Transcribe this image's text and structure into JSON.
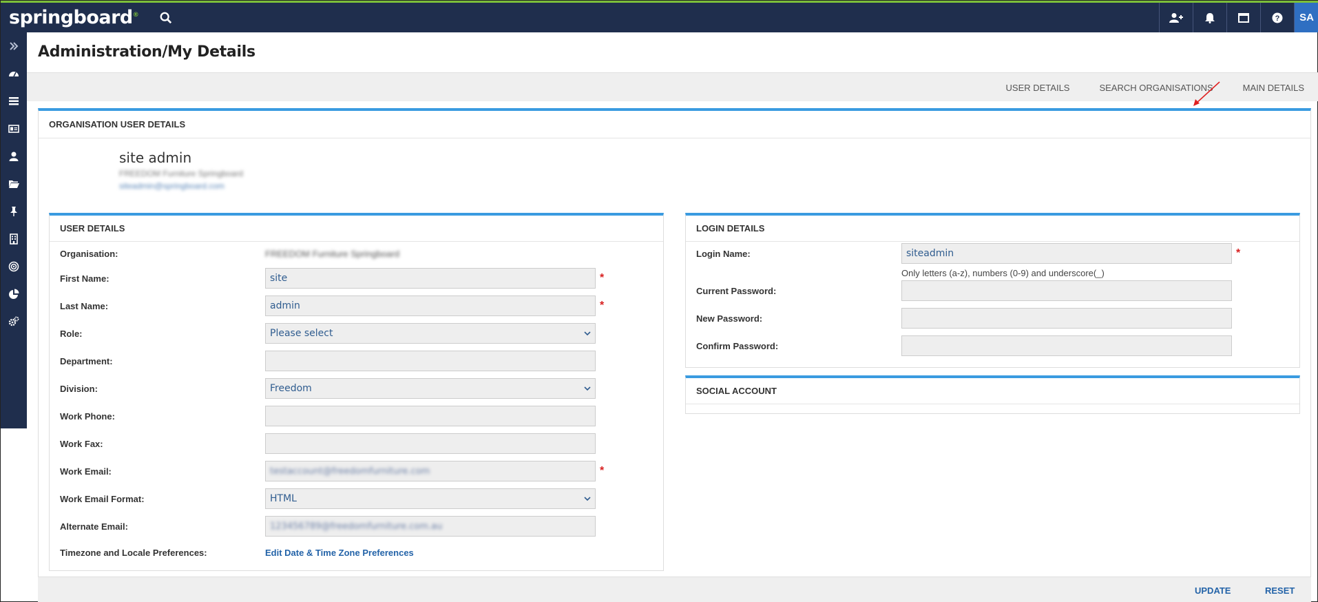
{
  "app": {
    "logo": "springboard",
    "logo_mark": "®"
  },
  "header": {
    "avatar_initials": "SA",
    "icons": [
      "search-icon",
      "add-user-icon",
      "bell-icon",
      "window-icon",
      "help-icon"
    ]
  },
  "page": {
    "title": "Administration/My Details"
  },
  "tabs": [
    {
      "label": "USER DETAILS"
    },
    {
      "label": "SEARCH ORGANISATIONS"
    },
    {
      "label": "MAIN DETAILS"
    }
  ],
  "org_section": {
    "title": "ORGANISATION USER DETAILS",
    "name": "site admin",
    "org_line": "FREEDOM Furniture Springboard",
    "email_line": "siteadmin@springboard.com"
  },
  "user_details": {
    "title": "USER DETAILS",
    "organisation": {
      "label": "Organisation:",
      "value": "FREEDOM Furniture Springboard"
    },
    "first_name": {
      "label": "First Name:",
      "value": "site"
    },
    "last_name": {
      "label": "Last Name:",
      "value": "admin"
    },
    "role": {
      "label": "Role:",
      "value": "Please select"
    },
    "department": {
      "label": "Department:",
      "value": ""
    },
    "division": {
      "label": "Division:",
      "value": "Freedom"
    },
    "work_phone": {
      "label": "Work Phone:",
      "value": ""
    },
    "work_fax": {
      "label": "Work Fax:",
      "value": ""
    },
    "work_email": {
      "label": "Work Email:",
      "value": "testaccount@freedomfurniture.com"
    },
    "work_email_format": {
      "label": "Work Email Format:",
      "value": "HTML"
    },
    "alternate_email": {
      "label": "Alternate Email:",
      "value": "123456789@freedomfurniture.com.au"
    },
    "timezone": {
      "label": "Timezone and Locale Preferences:",
      "link": "Edit Date & Time Zone Preferences"
    },
    "required_mark": "*"
  },
  "login_details": {
    "title": "LOGIN DETAILS",
    "login_name": {
      "label": "Login Name:",
      "value": "siteadmin"
    },
    "hint": "Only letters (a-z), numbers (0-9) and underscore(_)",
    "current_password": {
      "label": "Current Password:",
      "value": ""
    },
    "new_password": {
      "label": "New Password:",
      "value": ""
    },
    "confirm_password": {
      "label": "Confirm Password:",
      "value": ""
    }
  },
  "social_account": {
    "title": "SOCIAL ACCOUNT"
  },
  "footer": {
    "update_label": "UPDATE",
    "reset_label": "RESET"
  },
  "colors": {
    "topbar": "#1f2e4d",
    "accent": "#3a9be0",
    "brand_green": "#7cbf3a",
    "link": "#2363a8",
    "required": "#d82020"
  }
}
